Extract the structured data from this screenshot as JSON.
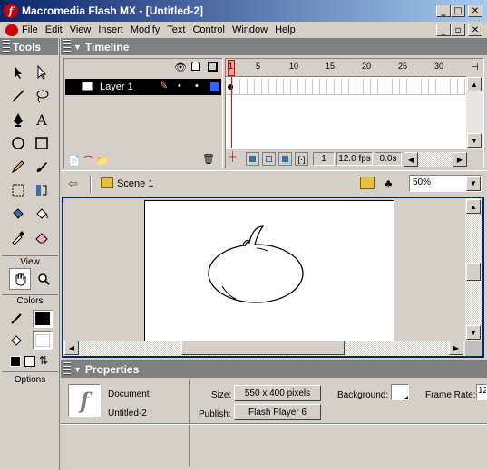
{
  "window": {
    "title": "Macromedia Flash MX - [Untitled-2]",
    "controls": {
      "minimize": "_",
      "maximize": "□",
      "close": "✕"
    }
  },
  "menu": [
    "File",
    "Edit",
    "View",
    "Insert",
    "Modify",
    "Text",
    "Control",
    "Window",
    "Help"
  ],
  "tools": {
    "header": "Tools",
    "view_label": "View",
    "colors_label": "Colors",
    "options_label": "Options",
    "stroke_color": "#000000",
    "fill_color": "#ffffff"
  },
  "timeline": {
    "header": "Timeline",
    "frame_numbers": [
      "1",
      "5",
      "10",
      "15",
      "20",
      "25",
      "30"
    ],
    "layer_name": "Layer 1",
    "current_frame": "1",
    "frame_rate": "12.0 fps",
    "elapsed": "0.0s",
    "playhead_color": "#ff0000",
    "layer_outline_color": "#3366ff"
  },
  "edit_bar": {
    "scene": "Scene 1",
    "zoom": "50%"
  },
  "properties": {
    "header": "Properties",
    "type_label": "Document",
    "doc_name": "Untitled-2",
    "size_label": "Size:",
    "size_value": "550 x 400 pixels",
    "publish_label": "Publish:",
    "publish_value": "Flash Player 6",
    "background_label": "Background:",
    "background_color": "#ffffff",
    "frame_rate_label": "Frame Rate:",
    "frame_rate_value": "12"
  }
}
